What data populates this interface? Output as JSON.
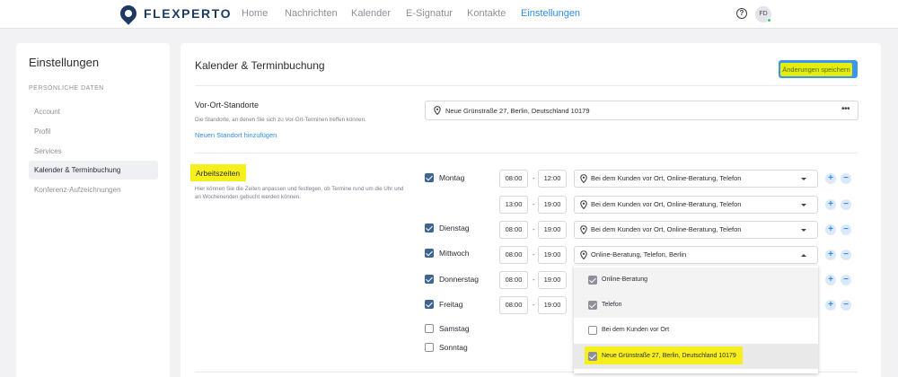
{
  "app": {
    "logo": "FLEXPERTO"
  },
  "nav": {
    "items": [
      {
        "label": "Home"
      },
      {
        "label": "Nachrichten"
      },
      {
        "label": "Kalender"
      },
      {
        "label": "E-Signatur"
      },
      {
        "label": "Kontakte"
      },
      {
        "label": "Einstellungen",
        "active": true
      }
    ],
    "help": "?",
    "avatar_initials": "FD"
  },
  "sidebar": {
    "title": "Einstellungen",
    "section": "PERSÖNLICHE DATEN",
    "items": [
      {
        "label": "Account"
      },
      {
        "label": "Profil"
      },
      {
        "label": "Services"
      },
      {
        "label": "Kalender & Terminbuchung",
        "active": true
      },
      {
        "label": "Konferenz-Aufzeichnungen"
      }
    ]
  },
  "main": {
    "title": "Kalender & Terminbuchung",
    "save_label": "Änderungen speichern",
    "locations": {
      "title": "Vor-Ort-Standorte",
      "description": "Die Standorte, an denen Sie sich zu Vor-Ort-Terminen treffen können.",
      "add_link": "Neuen Standort hinzufügen",
      "value": "Neue Grünstraße 27, Berlin, Deutschland 10179",
      "more": "•••"
    },
    "hours": {
      "title": "Arbeitszeiten",
      "description": "Hier können Sie die Zeiten anpassen und festlegen, ob Termine rund um die Uhr und an Wochenenden gebucht werden können.",
      "dash": "-",
      "rows": [
        {
          "day": "Montag",
          "checked": true,
          "from": "08:00",
          "to": "12:00",
          "locations": "Bei dem Kunden vor Ort, Online-Beratung, Telefon"
        },
        {
          "day": "",
          "from": "13:00",
          "to": "19:00",
          "locations": "Bei dem Kunden vor Ort, Online-Beratung, Telefon"
        },
        {
          "day": "Dienstag",
          "checked": true,
          "from": "08:00",
          "to": "19:00",
          "locations": "Bei dem Kunden vor Ort, Online-Beratung, Telefon"
        },
        {
          "day": "Mittwoch",
          "checked": true,
          "from": "08:00",
          "to": "19:00",
          "locations": "Online-Beratung, Telefon, Berlin",
          "open": true
        },
        {
          "day": "Donnerstag",
          "checked": true,
          "from": "08:00",
          "to": "19:00"
        },
        {
          "day": "Freitag",
          "checked": true,
          "from": "08:00",
          "to": "19:00"
        },
        {
          "day": "Samstag",
          "checked": false
        },
        {
          "day": "Sonntag",
          "checked": false
        }
      ]
    },
    "dropdown": {
      "options": [
        {
          "label": "Online-Beratung",
          "checked": true
        },
        {
          "label": "Telefon",
          "checked": true
        },
        {
          "label": "Bei dem Kunden vor Ort",
          "checked": false
        },
        {
          "label": "Neue Grünstraße 27, Berlin, Deutschland 10179",
          "checked": true,
          "highlighted": true
        }
      ]
    },
    "plus": "+",
    "minus": "−"
  },
  "colors": {
    "accent": "#2f8df0",
    "checkbox": "#3e6592",
    "highlight": "#f7ef1b",
    "save_highlight": "#e4ec10"
  }
}
